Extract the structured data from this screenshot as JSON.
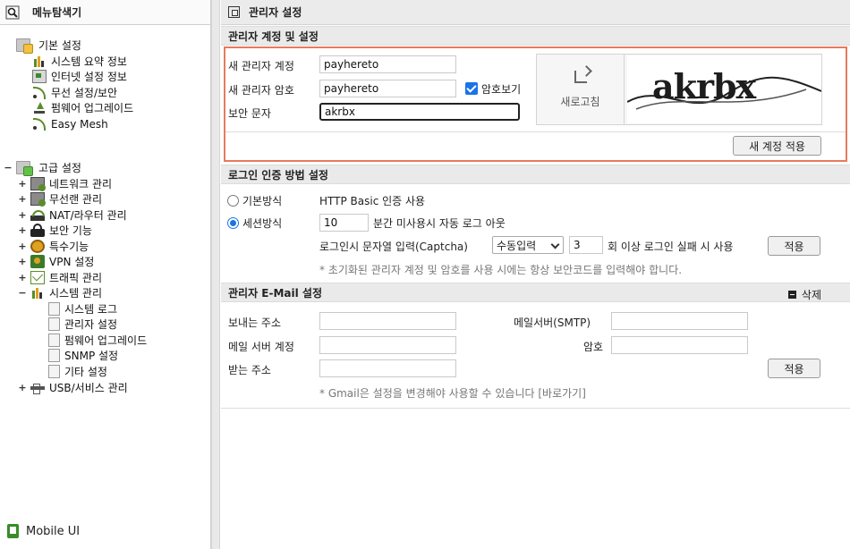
{
  "left_panel": {
    "title": "메뉴탐색기",
    "groups": [
      {
        "label": "기본 설정",
        "items": [
          "시스템 요약 정보",
          "인터넷 설정 정보",
          "무선 설정/보안",
          "펌웨어 업그레이드",
          "Easy Mesh"
        ]
      },
      {
        "label": "고급 설정",
        "items": [
          "네트워크 관리",
          "무선랜 관리",
          "NAT/라우터 관리",
          "보안 기능",
          "특수기능",
          "VPN 설정",
          "트래픽 관리",
          "시스템 관리",
          "USB/서비스 관리"
        ],
        "expanded_item": {
          "label": "시스템 관리",
          "children": [
            "시스템 로그",
            "관리자 설정",
            "펌웨어 업그레이드",
            "SNMP 설정",
            "기타 설정"
          ]
        }
      }
    ],
    "mobile_ui": "Mobile UI"
  },
  "main": {
    "header_title": "관리자 설정",
    "account": {
      "section_title": "관리자 계정 및 설정",
      "new_admin_account_label": "새 관리자 계정",
      "new_admin_account_value": "payhereto",
      "new_admin_password_label": "새 관리자 암호",
      "new_admin_password_value": "payhereto",
      "show_password_label": "암호보기",
      "show_password_checked": true,
      "security_text_label": "보안 문자",
      "security_text_value": "akrbx",
      "refresh_label": "새로고침",
      "captcha_text": "akrbx",
      "apply_button": "새 계정 적용"
    },
    "login_auth": {
      "section_title": "로그인 인증 방법 설정",
      "basic_label": "기본방식",
      "basic_desc": "HTTP Basic 인증 사용",
      "session_label": "세션방식",
      "session_selected": true,
      "timeout_value": "10",
      "timeout_suffix": "분간 미사용시 자동 로그 아웃",
      "captcha_label": "로그인시 문자열 입력(Captcha)",
      "captcha_select": "수동입력",
      "fail_count": "3",
      "fail_suffix": "회 이상 로그인 실패 시 사용",
      "apply_button": "적용",
      "note": "* 초기화된 관리자 계정 및 암호를 사용 시에는 항상 보안코드를 입력해야 합니다."
    },
    "email": {
      "section_title": "관리자 E-Mail 설정",
      "delete_label": "삭제",
      "sender_label": "보내는 주소",
      "smtp_label": "메일서버(SMTP)",
      "account_label": "메일 서버 계정",
      "password_label": "암호",
      "receiver_label": "받는 주소",
      "apply_button": "적용",
      "note": "* Gmail은 설정을 변경해야 사용할 수 있습니다 [바로가기]"
    }
  },
  "colors": {
    "highlight_border": "#e77a5e",
    "checkbox_blue": "#1a73e8",
    "section_bg": "#eaeaea"
  }
}
